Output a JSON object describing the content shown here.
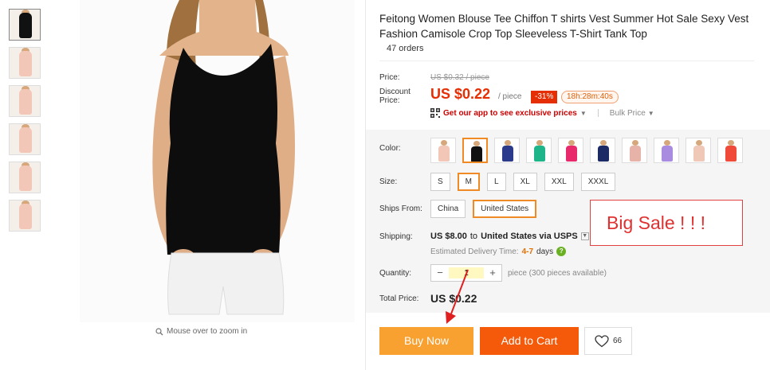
{
  "product": {
    "title": "Feitong Women Blouse Tee Chiffon T shirts Vest Summer Hot Sale Sexy Vest Fashion Camisole Crop Top Sleeveless T-Shirt Tank Top",
    "orders": "47 orders"
  },
  "gallery": {
    "zoom_hint": "Mouse over to zoom in",
    "thumbnails": [
      {
        "color": "#111111"
      },
      {
        "color": "#f2c7b8"
      },
      {
        "color": "#f2c7b8"
      },
      {
        "color": "#f2c7b8"
      },
      {
        "color": "#f2c7b8"
      },
      {
        "color": "#f2c7b8"
      }
    ]
  },
  "pricing": {
    "price_label": "Price:",
    "original_price": "US $0.32 / piece",
    "discount_label_1": "Discount",
    "discount_label_2": "Price:",
    "price": "US $0.22",
    "per": "/ piece",
    "discount_badge": "-31%",
    "timer": "18h:28m:40s",
    "app_promo": "Get our app to see exclusive prices",
    "bulk_price": "Bulk Price"
  },
  "options": {
    "color_label": "Color:",
    "colors": [
      "#f2c7b8",
      "#111111",
      "#2b3a8a",
      "#1fb58a",
      "#e8296b",
      "#1c2a66",
      "#e7b3a8",
      "#a98be0",
      "#efc8b7",
      "#f04a3a"
    ],
    "selected_color_index": 1,
    "size_label": "Size:",
    "sizes": [
      "S",
      "M",
      "L",
      "XL",
      "XXL",
      "XXXL"
    ],
    "selected_size_index": 1,
    "ships_from_label": "Ships From:",
    "ships_from": [
      "China",
      "United States"
    ],
    "selected_ships_from_index": 1
  },
  "shipping": {
    "label": "Shipping:",
    "cost": "US $8.00",
    "to_word": "to",
    "destination": "United States via USPS",
    "estimated_label": "Estimated Delivery Time:",
    "days_range": "4-7",
    "days_word": "days"
  },
  "quantity": {
    "label": "Quantity:",
    "value": "1",
    "note": "piece (300 pieces available)"
  },
  "total": {
    "label": "Total Price:",
    "value": "US $0.22"
  },
  "annotation": {
    "big_sale": "Big Sale ! ! !"
  },
  "actions": {
    "buy_now": "Buy Now",
    "add_to_cart": "Add to Cart",
    "wishlist_count": "66"
  },
  "colors": {
    "price_red": "#e62e04",
    "buy_now_bg": "#f8a030",
    "add_to_cart_bg": "#f45a0a",
    "selected_border": "#f08a24"
  }
}
